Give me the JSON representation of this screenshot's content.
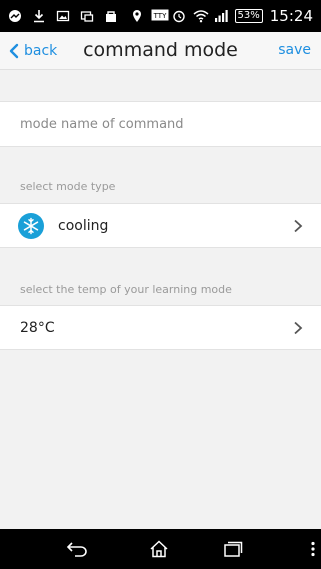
{
  "status_bar": {
    "battery": "53%",
    "time": "15:24",
    "icons": [
      "messenger-icon",
      "download-icon",
      "image-icon",
      "screen-icon",
      "lock-icon",
      "location-icon",
      "tty-icon",
      "alarm-icon",
      "wifi-icon",
      "signal-icon"
    ]
  },
  "header": {
    "back_label": "back",
    "title": "command mode",
    "save_label": "save"
  },
  "form": {
    "name_placeholder": "mode name of command",
    "mode_section_label": "select mode type",
    "mode_value": "cooling",
    "mode_icon": "snowflake-icon",
    "temp_section_label": "select the temp of your learning mode",
    "temp_value": "28°C"
  },
  "colors": {
    "accent": "#1f8fe0",
    "mode_icon_bg": "#1aa0d8"
  }
}
